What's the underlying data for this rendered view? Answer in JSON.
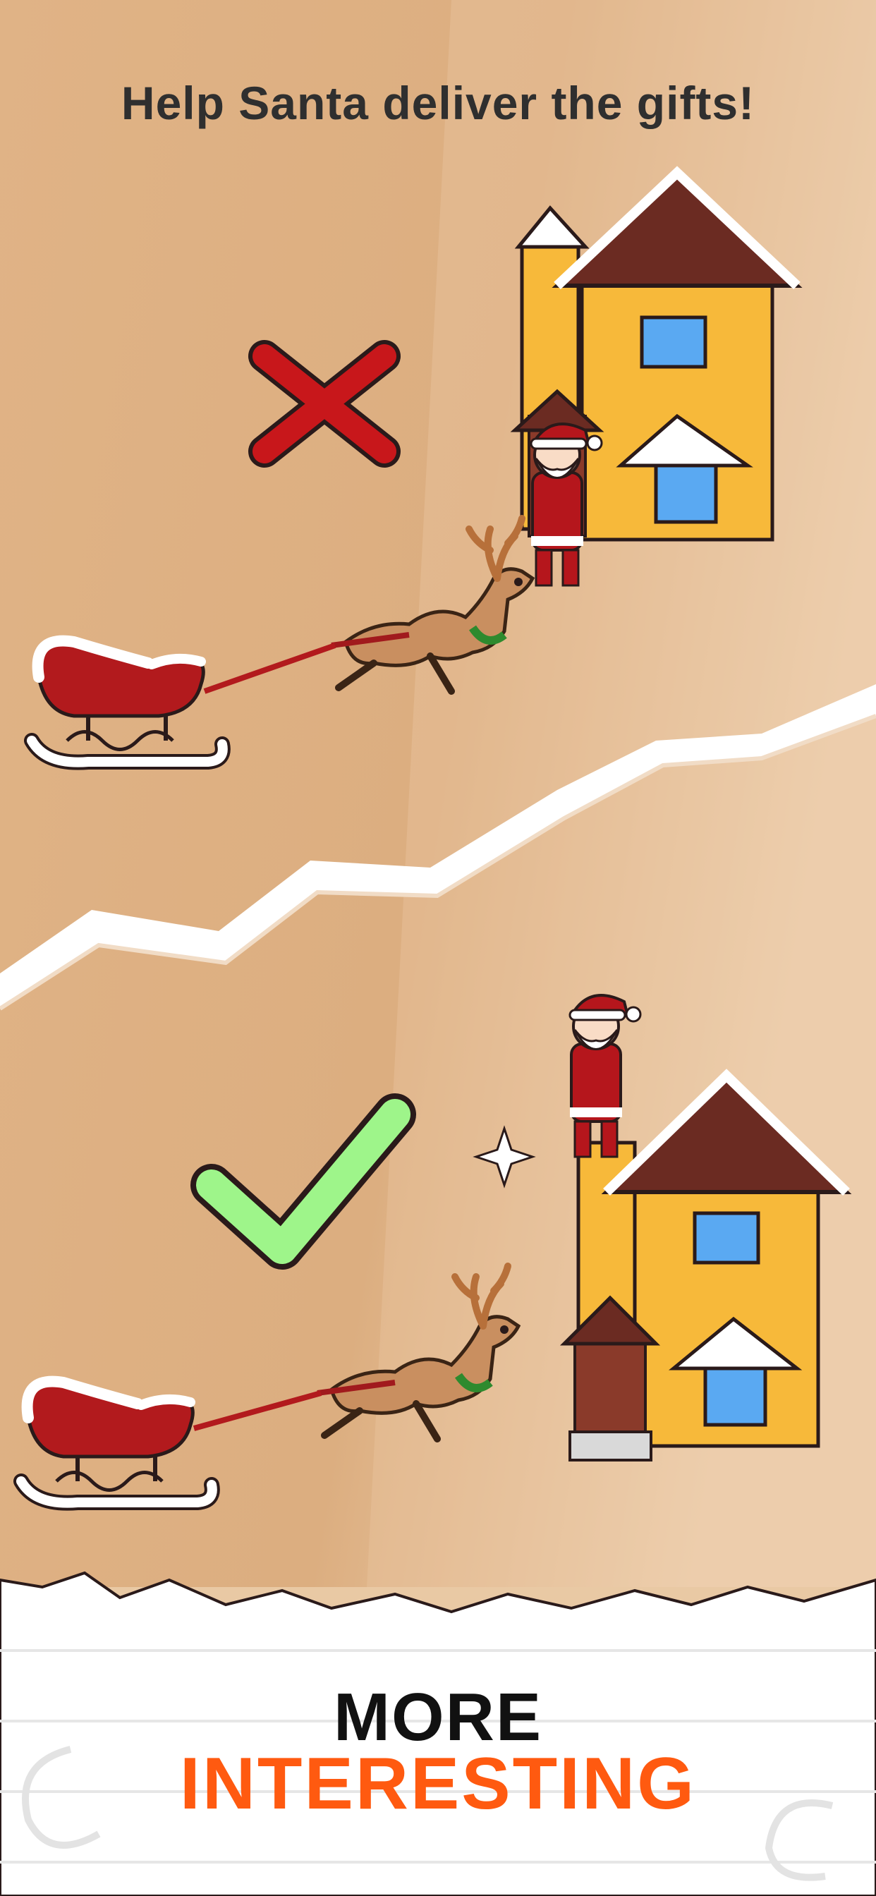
{
  "heading": "Help Santa deliver the gifts!",
  "panels": [
    {
      "name": "wrong-example",
      "indicator_icon": "cross-mark-icon",
      "indicator_color": "#c8171b",
      "santa_position": "beside-door"
    },
    {
      "name": "correct-example",
      "indicator_icon": "check-mark-icon",
      "indicator_color": "#9ef58a",
      "santa_position": "on-chimney-tower"
    }
  ],
  "footer": {
    "line1": "MORE",
    "line2": "INTERESTING"
  },
  "colors": {
    "paper": "#dfb185",
    "paper_light": "#f0d7bb",
    "accent": "#ff5a10",
    "santa_red": "#b5161c",
    "house_yellow": "#f7b93a",
    "roof_brown": "#6b2b22"
  }
}
